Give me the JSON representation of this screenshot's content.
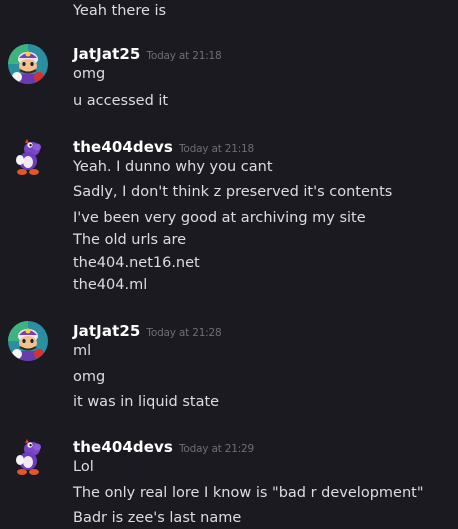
{
  "messages": {
    "prev_line": "Yeah there is",
    "groups": [
      {
        "username": "JatJat25",
        "timestamp": "Today at 21:18",
        "avatar": "wario-avatar",
        "lines": [
          "omg",
          "u accessed it"
        ]
      },
      {
        "username": "the404devs",
        "timestamp": "Today at 21:18",
        "avatar": "purple-yoshi-avatar",
        "lines": [
          "Yeah. I dunno why you cant",
          "Sadly, I don't think z preserved it's contents",
          "I've been very good at archiving my site",
          "The old urls are",
          "the404.net16.net",
          "the404.ml"
        ]
      },
      {
        "username": "JatJat25",
        "timestamp": "Today at 21:28",
        "avatar": "wario-avatar",
        "lines": [
          "ml",
          "omg",
          "it was in liquid state"
        ]
      },
      {
        "username": "the404devs",
        "timestamp": "Today at 21:29",
        "avatar": "purple-yoshi-avatar",
        "lines": [
          "Lol",
          "The only real lore I know is \"bad r development\"",
          "Badr is zee's last name"
        ]
      }
    ]
  },
  "colors": {
    "background": "#1c1a21",
    "text": "#dcdde1",
    "username": "#ffffff",
    "timestamp": "#6f6c78"
  }
}
